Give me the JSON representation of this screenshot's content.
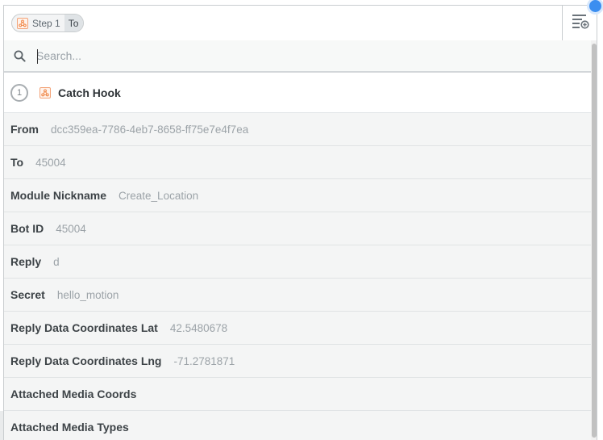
{
  "header": {
    "step_label": "Step 1",
    "field_label": "To",
    "app_icon": "webhook-icon",
    "menu_icon": "field-list-add-icon"
  },
  "search": {
    "placeholder": "Search...",
    "icon": "search-icon"
  },
  "step": {
    "number": "1",
    "title": "Catch Hook",
    "app_icon": "webhook-icon"
  },
  "fields": [
    {
      "key": "From",
      "value": "dcc359ea-7786-4eb7-8658-ff75e7e4f7ea"
    },
    {
      "key": "To",
      "value": "45004"
    },
    {
      "key": "Module Nickname",
      "value": "Create_Location"
    },
    {
      "key": "Bot ID",
      "value": "45004"
    },
    {
      "key": "Reply",
      "value": "d"
    },
    {
      "key": "Secret",
      "value": "hello_motion"
    },
    {
      "key": "Reply Data Coordinates Lat",
      "value": "42.5480678"
    },
    {
      "key": "Reply Data Coordinates Lng",
      "value": "-71.2781871"
    },
    {
      "key": "Attached Media Coords",
      "value": ""
    },
    {
      "key": "Attached Media Types",
      "value": ""
    }
  ],
  "colors": {
    "accent_orange": "#f08a4b",
    "focus_blue": "#3b8ef0"
  }
}
